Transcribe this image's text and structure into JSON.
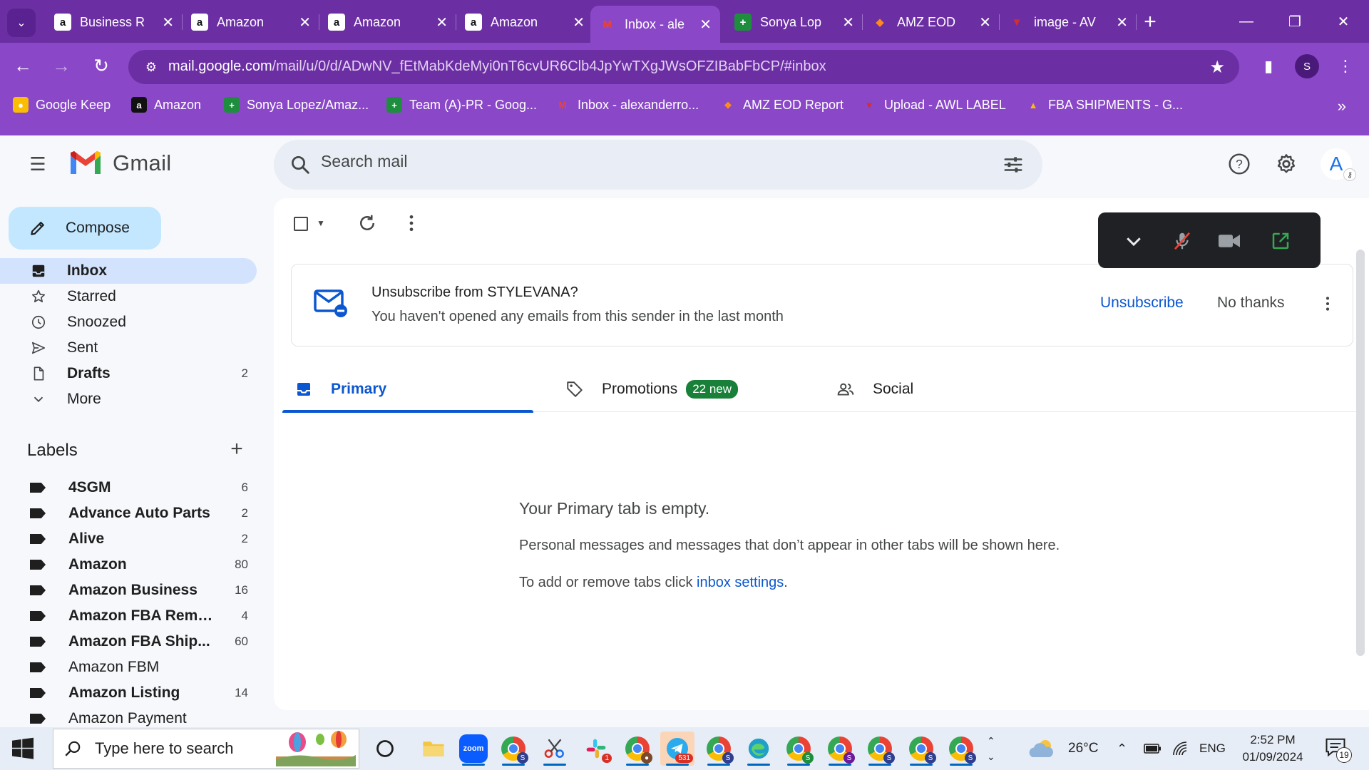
{
  "browser": {
    "tabs": [
      {
        "title": "Business R",
        "favicon": "amazon-icon"
      },
      {
        "title": "Amazon",
        "favicon": "amazon-icon"
      },
      {
        "title": "Amazon",
        "favicon": "amazon-icon"
      },
      {
        "title": "Amazon",
        "favicon": "amazon-icon"
      },
      {
        "title": "Inbox - ale",
        "favicon": "gmail-icon",
        "active": true
      },
      {
        "title": "Sonya Lop",
        "favicon": "sheets-icon"
      },
      {
        "title": "AMZ EOD",
        "favicon": "eod-report-icon"
      },
      {
        "title": "image - AV",
        "favicon": "awl-icon"
      }
    ],
    "url_host": "mail.google.com",
    "url_path": "/mail/u/0/d/ADwNV_fEtMabKdeMyi0nT6cvUR6Clb4JpYwTXgJWsOFZIBabFbCP/#inbox",
    "profile_initial": "S",
    "bookmarks": [
      {
        "label": "Google Keep",
        "icon": "keep-icon"
      },
      {
        "label": "Amazon",
        "icon": "amazon-icon"
      },
      {
        "label": "Sonya Lopez/Amaz...",
        "icon": "sheets-icon"
      },
      {
        "label": "Team (A)-PR - Goog...",
        "icon": "sheets-icon"
      },
      {
        "label": "Inbox - alexanderro...",
        "icon": "gmail-icon"
      },
      {
        "label": "AMZ EOD Report",
        "icon": "eod-report-icon"
      },
      {
        "label": "Upload - AWL LABEL",
        "icon": "awl-icon"
      },
      {
        "label": "FBA SHIPMENTS - G...",
        "icon": "drive-icon"
      }
    ]
  },
  "gmail": {
    "brand": "Gmail",
    "search_placeholder": "Search mail",
    "avatar_initial": "A",
    "compose_label": "Compose",
    "nav": [
      {
        "label": "Inbox",
        "count": "",
        "icon": "inbox-icon",
        "active": true,
        "bold": true
      },
      {
        "label": "Starred",
        "count": "",
        "icon": "star-icon"
      },
      {
        "label": "Snoozed",
        "count": "",
        "icon": "clock-icon"
      },
      {
        "label": "Sent",
        "count": "",
        "icon": "send-icon"
      },
      {
        "label": "Drafts",
        "count": "2",
        "icon": "draft-icon",
        "bold": true
      },
      {
        "label": "More",
        "count": "",
        "icon": "chevron-down-icon"
      }
    ],
    "labels_heading": "Labels",
    "labels": [
      {
        "label": "4SGM",
        "count": "6",
        "bold": true
      },
      {
        "label": "Advance Auto Parts",
        "count": "2",
        "bold": true
      },
      {
        "label": "Alive",
        "count": "2",
        "bold": true
      },
      {
        "label": "Amazon",
        "count": "80",
        "bold": true
      },
      {
        "label": "Amazon Business",
        "count": "16",
        "bold": true
      },
      {
        "label": "Amazon FBA Remo...",
        "count": "4",
        "bold": true
      },
      {
        "label": "Amazon FBA Ship...",
        "count": "60",
        "bold": true
      },
      {
        "label": "Amazon FBM",
        "count": "",
        "bold": false
      },
      {
        "label": "Amazon Listing",
        "count": "14",
        "bold": true
      },
      {
        "label": "Amazon Payment",
        "count": "",
        "bold": false
      }
    ],
    "banner": {
      "title": "Unsubscribe from STYLEVANA?",
      "subtitle": "You haven't opened any emails from this sender in the last month",
      "unsubscribe_label": "Unsubscribe",
      "no_thanks_label": "No thanks"
    },
    "tabs": [
      {
        "label": "Primary",
        "active": true
      },
      {
        "label": "Promotions",
        "badge": "22 new"
      },
      {
        "label": "Social"
      }
    ],
    "empty": {
      "title": "Your Primary tab is empty.",
      "body": "Personal messages and messages that don’t appear in other tabs will be shown here.",
      "settings_prefix": "To add or remove tabs click ",
      "settings_link": "inbox settings",
      "settings_suffix": "."
    }
  },
  "taskbar": {
    "search_placeholder": "Type here to search",
    "apps": [
      "cortana-icon",
      "file-explorer-icon",
      "zoom-icon",
      "chrome-icon",
      "snipping-tool-icon",
      "slack-icon",
      "chrome-icon",
      "telegram-icon",
      "chrome-icon",
      "edge-icon",
      "chrome-icon",
      "chrome-icon",
      "chrome-icon",
      "chrome-icon",
      "chrome-icon"
    ],
    "slack_badge": "1",
    "telegram_badge": "531",
    "zoom_label": "zoom",
    "weather": "26°C",
    "language": "ENG",
    "time": "2:52 PM",
    "date": "01/09/2024",
    "notifications": "19"
  },
  "colors": {
    "chrome_purple": "#8a47c8",
    "tabstrip_purple": "#6b2fa3",
    "gmail_blue": "#0b57d0",
    "compose_bg": "#c2e7ff",
    "active_nav": "#d3e3fd",
    "promo_badge": "#188038"
  }
}
